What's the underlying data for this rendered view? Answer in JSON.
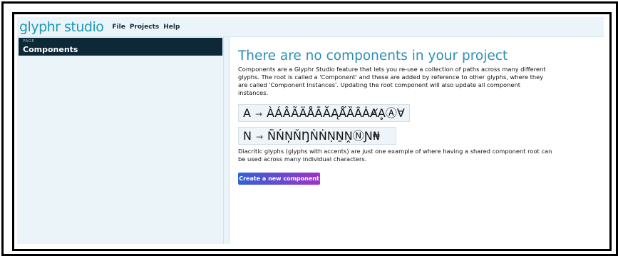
{
  "app": {
    "logo": "glyphr studio"
  },
  "menu": {
    "items": [
      "File",
      "Projects",
      "Help"
    ]
  },
  "sidebar": {
    "page_label": "PAGE",
    "page_name": "Components"
  },
  "main": {
    "heading": "There are no components in your project",
    "intro": "Components are a Glyphr Studio feature that lets you re-use a collection of paths across many different glyphs. The root is called a 'Component' and these are added by reference to other glyphs, where they are called 'Component Instances'. Updating the root component will also update all component instances.",
    "example_a": {
      "root": "A",
      "arrow": "→",
      "variants": "ÀÁÂÃÄÅĀĂĄǺȀȂȦȺḀⒶ∀"
    },
    "example_n": {
      "root": "N",
      "arrow": "→",
      "variants": "ÑŃŅŇŊǸṄṆṈṊⓃƝ₦"
    },
    "diacritic_note": "Diacritic glyphs (glyphs with accents) are just one example of where having a shared component root can be used across many individual characters.",
    "create_button": "Create a new component"
  }
}
